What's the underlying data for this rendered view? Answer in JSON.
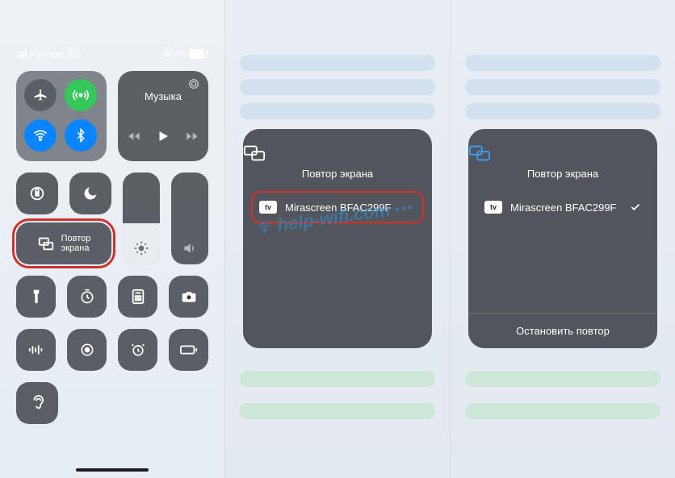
{
  "statusbar": {
    "carrier": "Kyivstar 3G",
    "battery_pct": "90 %",
    "battery_fill_pct": 90
  },
  "control_center": {
    "music_panel_title": "Музыка",
    "screen_mirror_label": "Повтор\nэкрана",
    "brightness_fill_pct": 45,
    "volume_fill_pct": 0
  },
  "mirroring_popover": {
    "title": "Повтор экрана",
    "device_name": "Mirascreen BFAC299F",
    "tv_badge": "tv",
    "stop_label": "Остановить повтор"
  },
  "watermark": {
    "text": "help-wifi.com"
  }
}
